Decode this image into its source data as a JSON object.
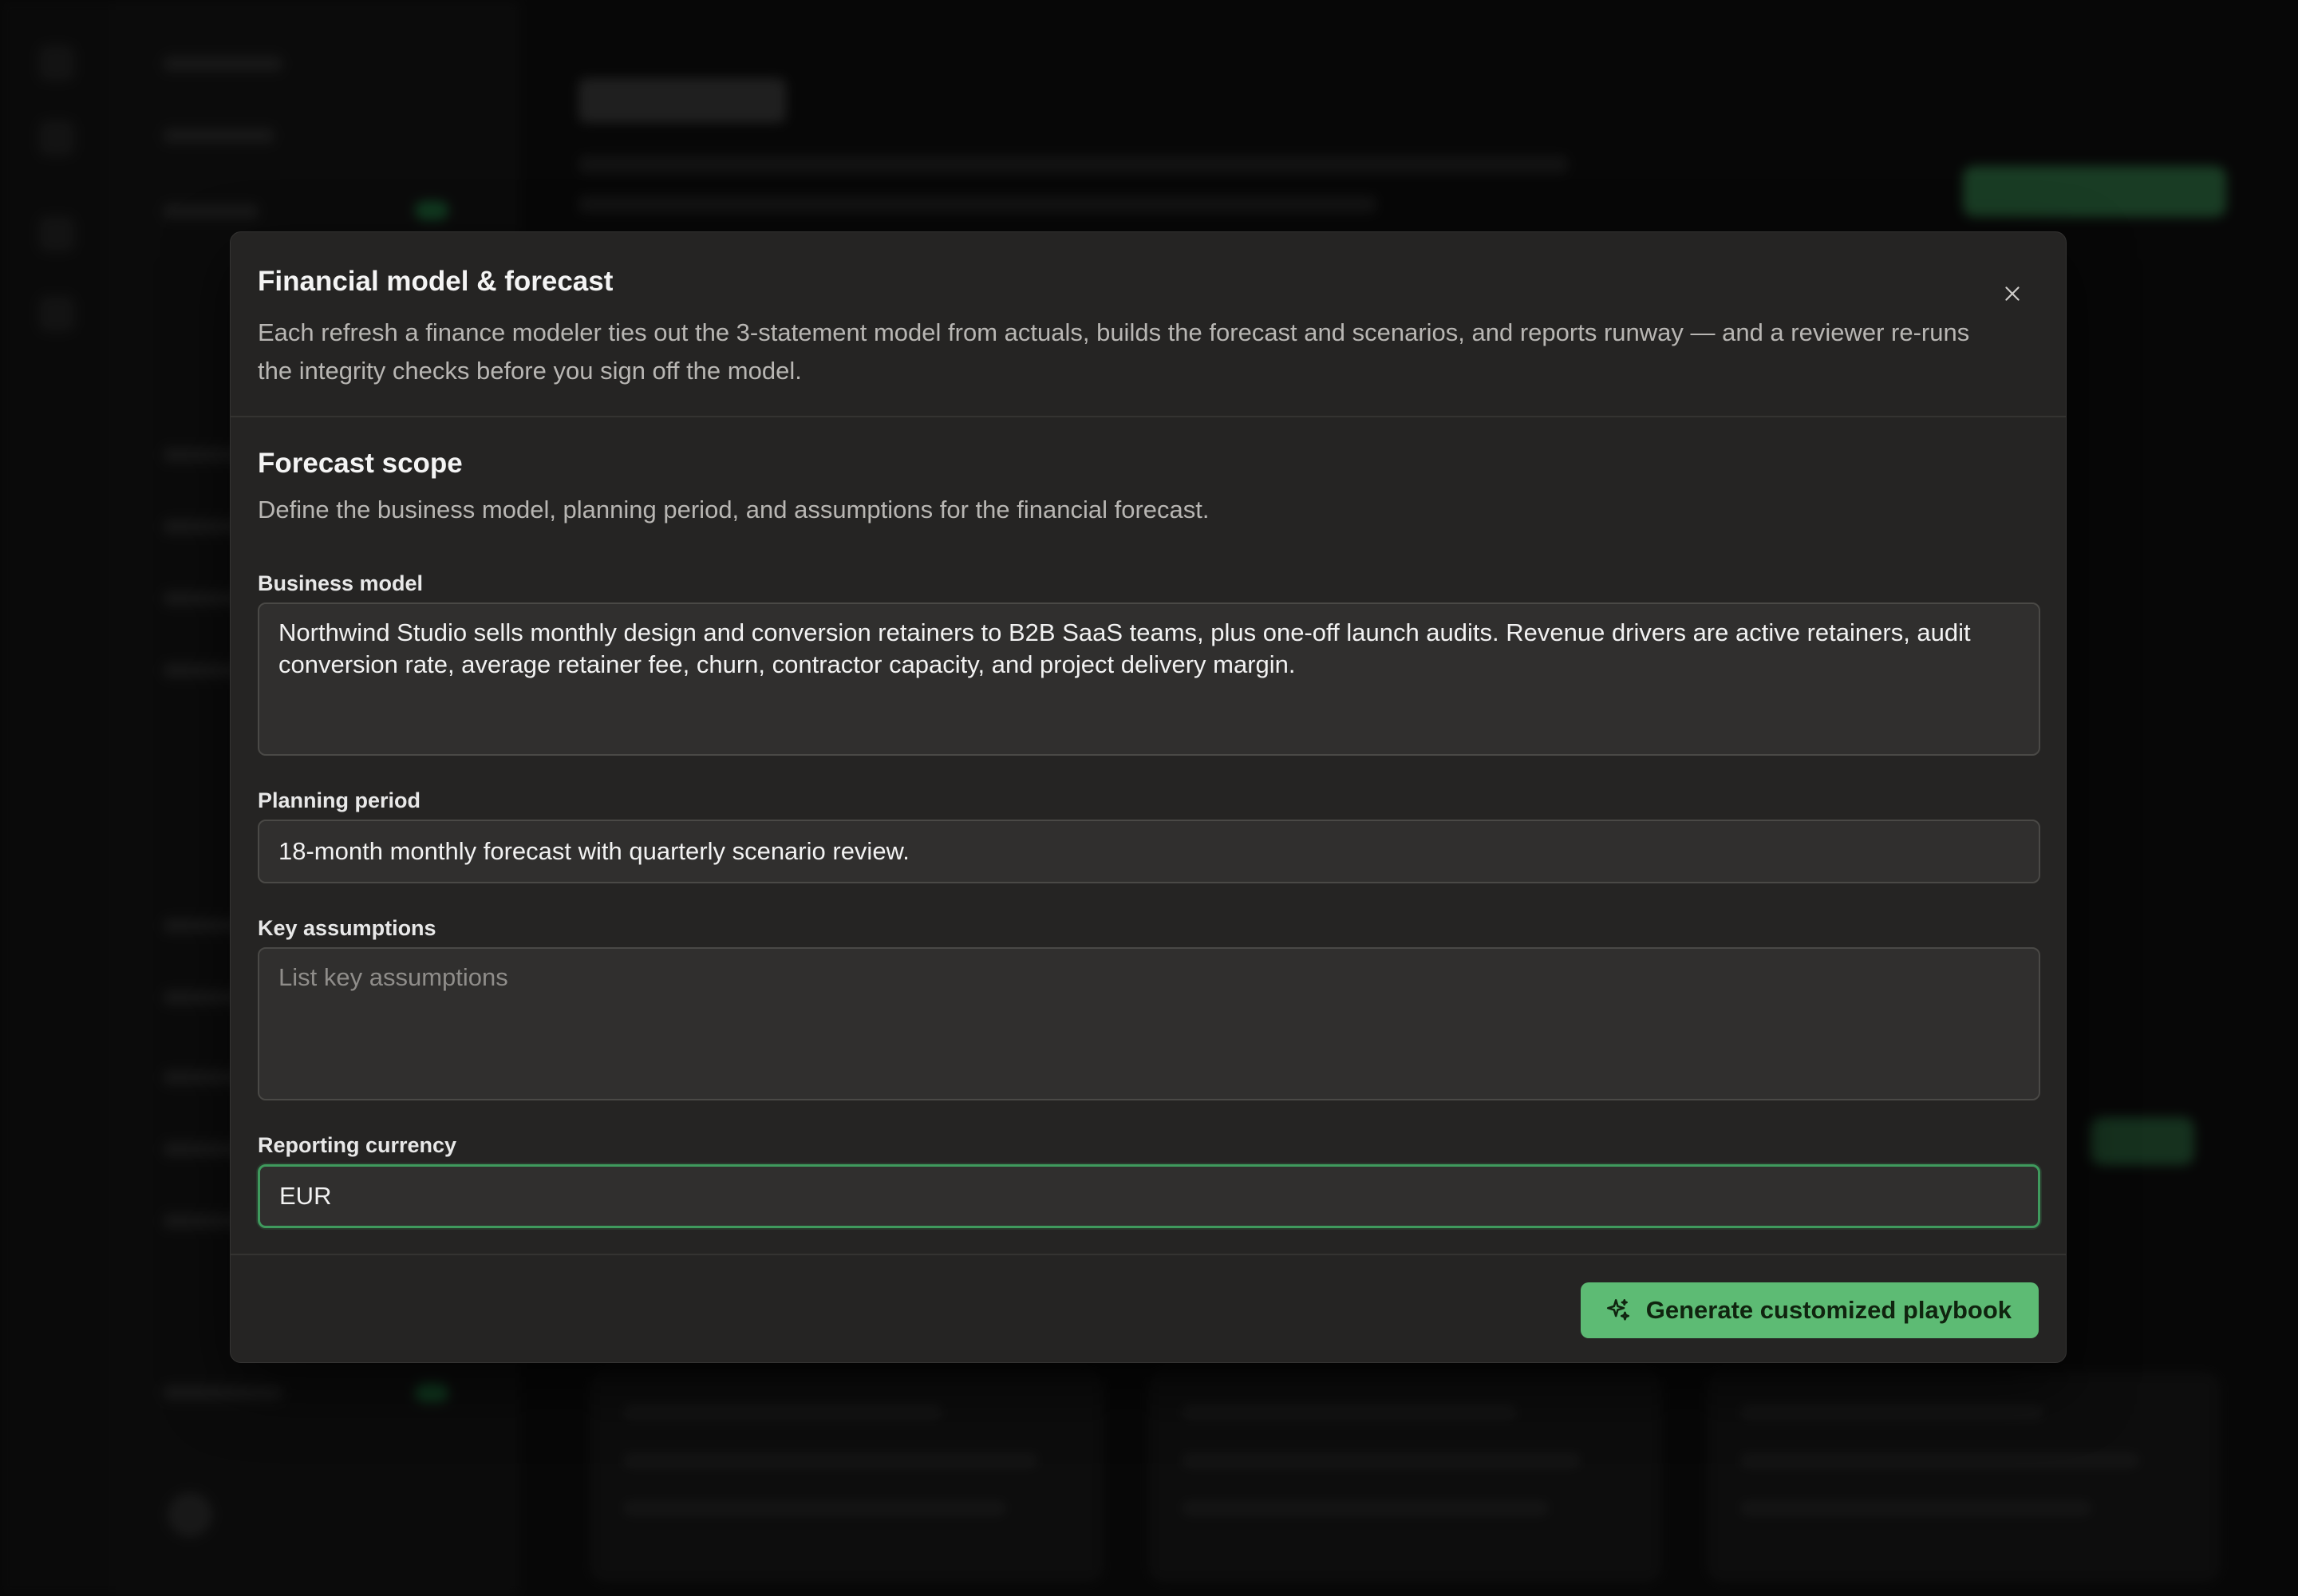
{
  "modal": {
    "title": "Financial model & forecast",
    "description": "Each refresh a finance modeler ties out the 3-statement model from actuals, builds the forecast and scenarios, and reports runway — and a reviewer re-runs the integrity checks before you sign off the model.",
    "close_icon": "close-icon"
  },
  "section": {
    "title": "Forecast scope",
    "description": "Define the business model, planning period, and assumptions for the financial forecast."
  },
  "fields": {
    "business_model": {
      "label": "Business model",
      "value": "Northwind Studio sells monthly design and conversion retainers to B2B SaaS teams, plus one-off launch audits. Revenue drivers are active retainers, audit conversion rate, average retainer fee, churn, contractor capacity, and project delivery margin."
    },
    "planning_period": {
      "label": "Planning period",
      "value": "18-month monthly forecast with quarterly scenario review."
    },
    "key_assumptions": {
      "label": "Key assumptions",
      "value": "",
      "placeholder": "List key assumptions"
    },
    "reporting_currency": {
      "label": "Reporting currency",
      "value": "EUR"
    }
  },
  "footer": {
    "generate_label": "Generate customized playbook",
    "generate_icon": "sparkles-icon"
  },
  "colors": {
    "accent": "#5dbb74",
    "focus_border": "#3f9a5d",
    "modal_bg": "#252423"
  }
}
